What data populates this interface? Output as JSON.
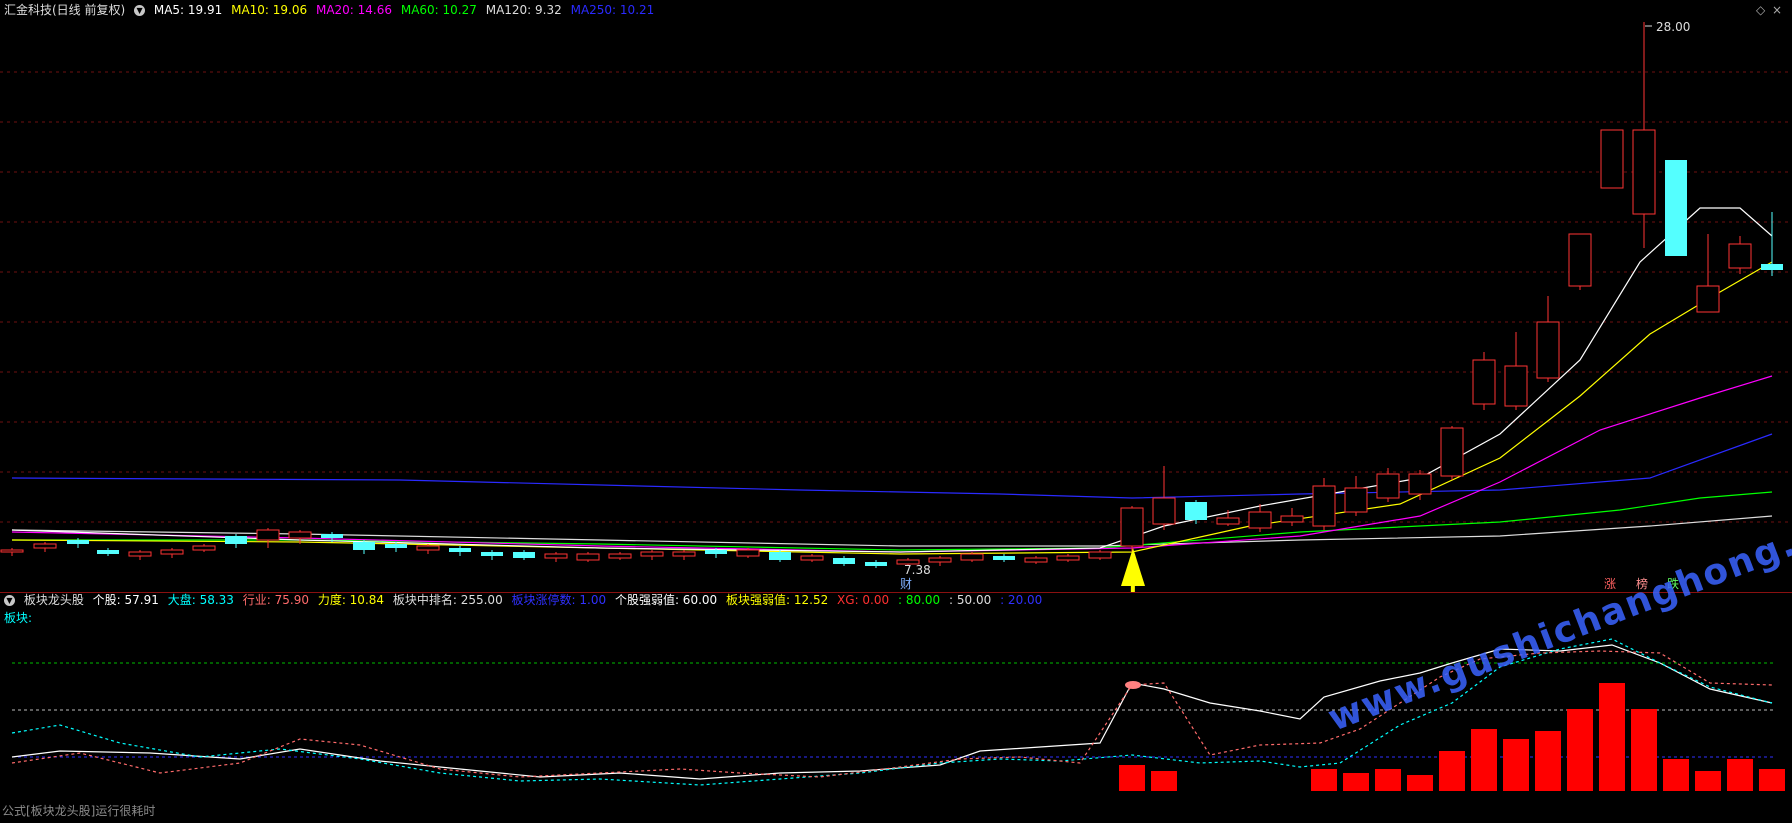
{
  "main_legend": {
    "stock_name": "汇金科技(日线 前复权)",
    "items": [
      {
        "label": "MA5: 19.91",
        "color": "#ffffff"
      },
      {
        "label": "MA10: 19.06",
        "color": "#ffff00"
      },
      {
        "label": "MA20: 14.66",
        "color": "#ff00ff"
      },
      {
        "label": "MA60: 10.27",
        "color": "#00ff00"
      },
      {
        "label": "MA120: 9.32",
        "color": "#dddddd"
      },
      {
        "label": "MA250: 10.21",
        "color": "#2a2aff"
      }
    ]
  },
  "annotations": {
    "high_price": "28.00",
    "low_price": "7.38",
    "fin_marker": "财",
    "mark_zhang": "涨",
    "mark_bang": "榜",
    "mark_die": "跌"
  },
  "indicator_legend": {
    "name": "板块龙头股",
    "items": [
      {
        "label": "个股: 57.91",
        "color": "#ffffff"
      },
      {
        "label": "大盘: 58.33",
        "color": "#00ffff"
      },
      {
        "label": "行业: 75.90",
        "color": "#ff6b6b"
      },
      {
        "label": "力度: 10.84",
        "color": "#ffff00"
      },
      {
        "label": "板块中排名: 255.00",
        "color": "#dddddd"
      },
      {
        "label": "板块涨停数: 1.00",
        "color": "#3030ff"
      },
      {
        "label": "个股强弱值: 60.00",
        "color": "#ffffff"
      },
      {
        "label": "板块强弱值: 12.52",
        "color": "#ffff00"
      },
      {
        "label": "XG: 0.00",
        "color": "#ff3030"
      },
      {
        "label": ": 80.00",
        "color": "#00ff00"
      },
      {
        "label": ": 50.00",
        "color": "#dddddd"
      },
      {
        "label": ": 20.00",
        "color": "#3030ff"
      }
    ],
    "sector_label": "板块:"
  },
  "footer_text": "公式[板块龙头股]运行很耗时",
  "watermark": "www.gushichanghong.com",
  "colors": {
    "up": "#ff3333",
    "down": "#54ffff",
    "grid": "#6e1010",
    "arrow": "#ffff00"
  }
}
